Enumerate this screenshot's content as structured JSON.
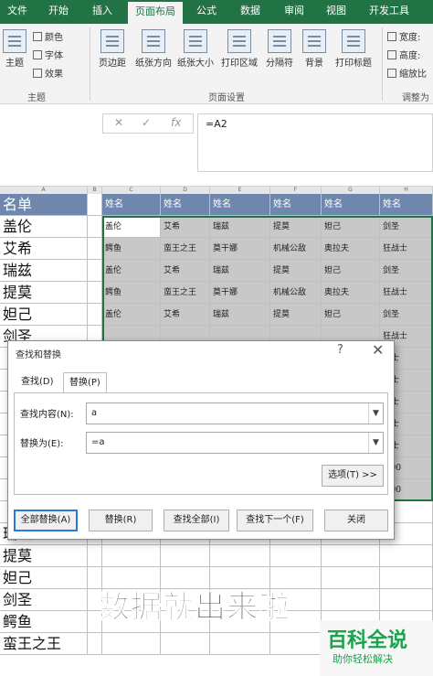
{
  "ribbon": {
    "tabs": [
      "文件",
      "开始",
      "插入",
      "页面布局",
      "公式",
      "数据",
      "审阅",
      "视图",
      "开发工具"
    ],
    "active_tab_index": 3,
    "theme": {
      "big": "主题",
      "colors": "颜色",
      "fonts": "字体",
      "effects": "效果",
      "group": "主题"
    },
    "page_setup": {
      "margins": "页边距",
      "orientation": "纸张方向",
      "size": "纸张大小",
      "print_area": "打印区域",
      "breaks": "分隔符",
      "background": "背景",
      "print_titles": "打印标题",
      "group": "页面设置"
    },
    "scale": {
      "width": "宽度:",
      "height": "高度:",
      "scale": "缩放比",
      "group": "调整为"
    }
  },
  "formula_bar": {
    "cancel": "✕",
    "enter": "✓",
    "fx": "fx",
    "value": "=A2"
  },
  "sheet": {
    "col_headers": [
      "A",
      "B",
      "C",
      "D",
      "E",
      "F",
      "G",
      "H"
    ],
    "col_a": [
      "名单",
      "盖伦",
      "艾希",
      "瑞兹",
      "提莫",
      "妲己",
      "剑圣",
      "",
      "",
      "",
      "",
      "",
      "",
      "",
      "",
      "瑞兹",
      "提莫",
      "妲己",
      "剑圣",
      "鳄鱼",
      "蛮王之王"
    ],
    "table_header": [
      "姓名",
      "姓名",
      "姓名",
      "姓名",
      "姓名",
      "姓名"
    ],
    "table_rows": [
      [
        "盖伦",
        "艾希",
        "瑞兹",
        "提莫",
        "妲己",
        "剑圣"
      ],
      [
        "鳄鱼",
        "蛮王之王",
        "莫干娜",
        "机械公敌",
        "奥拉夫",
        "狂战士"
      ],
      [
        "盖伦",
        "艾希",
        "瑞兹",
        "提莫",
        "妲己",
        "剑圣"
      ],
      [
        "鳄鱼",
        "蛮王之王",
        "莫干娜",
        "机械公敌",
        "奥拉夫",
        "狂战士"
      ],
      [
        "盖伦",
        "艾希",
        "瑞兹",
        "提莫",
        "妲己",
        "剑圣"
      ],
      [
        "",
        "",
        "",
        "",
        "",
        "狂战士"
      ],
      [
        "",
        "",
        "",
        "",
        "",
        "战士"
      ],
      [
        "",
        "",
        "",
        "",
        "",
        "战士"
      ],
      [
        "",
        "",
        "",
        "",
        "",
        "战士"
      ],
      [
        "",
        "",
        "",
        "",
        "",
        "战士"
      ],
      [
        "",
        "",
        "",
        "",
        "",
        "战士"
      ],
      [
        "",
        "",
        "",
        "",
        "",
        "0.00"
      ],
      [
        "",
        "",
        "",
        "",
        "",
        "0.00"
      ]
    ]
  },
  "dialog": {
    "title": "查找和替换",
    "help": "?",
    "close": "✕",
    "tab_find": "查找(D)",
    "tab_replace": "替换(P)",
    "find_label": "查找内容(N):",
    "find_value": "a",
    "replace_label": "替换为(E):",
    "replace_value": "=a",
    "options": "选项(T) >>",
    "replace_all": "全部替换(A)",
    "replace": "替换(R)",
    "find_all": "查找全部(I)",
    "find_next": "查找下一个(F)",
    "close_btn": "关闭"
  },
  "overlay_caption": "数据就出来啦",
  "watermark": {
    "main": "百科全说",
    "sub": "助你轻松解决"
  }
}
